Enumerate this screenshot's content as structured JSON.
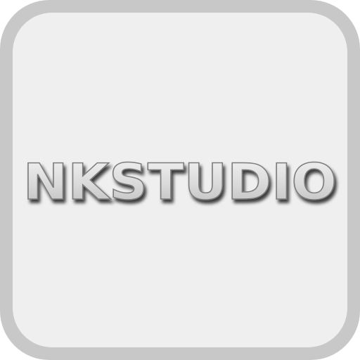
{
  "app_icon": {
    "logo_text": "NKSTUDIO",
    "colors": {
      "frame": "#c8c8c8",
      "face": "#efefef",
      "logo_fill": "#dcdcdc",
      "logo_stroke": "#7d7d7d",
      "logo_shadow": "#3a3a3a"
    }
  }
}
